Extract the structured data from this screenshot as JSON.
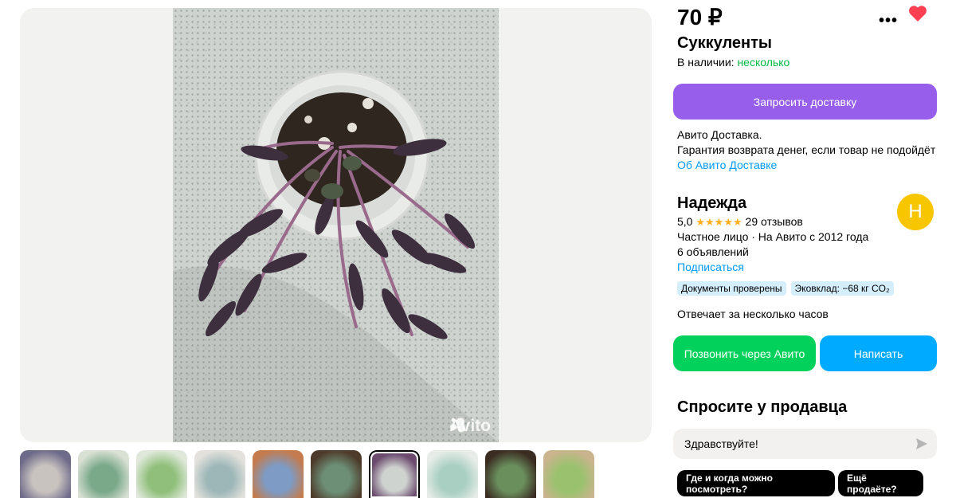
{
  "gallery": {
    "watermark": "Avito",
    "thumbnails": [
      {
        "colors": [
          "#c8c3bf",
          "#6e6a8a"
        ]
      },
      {
        "colors": [
          "#7aa98a",
          "#d9e0d4"
        ]
      },
      {
        "colors": [
          "#8fbf7a",
          "#dfe8da"
        ]
      },
      {
        "colors": [
          "#9db7b8",
          "#e3e1dc"
        ]
      },
      {
        "colors": [
          "#7d9bc4",
          "#c47b4d"
        ]
      },
      {
        "colors": [
          "#6d8f76",
          "#4d3a2a"
        ]
      },
      {
        "colors": [
          "#cfd3d0",
          "#6b4a6e"
        ],
        "active": true
      },
      {
        "colors": [
          "#a8cfc2",
          "#e7ece8"
        ]
      },
      {
        "colors": [
          "#6a8f5d",
          "#3b2c22"
        ]
      },
      {
        "colors": [
          "#9ac26e",
          "#c9b48d"
        ]
      }
    ]
  },
  "listing": {
    "price": "70 ₽",
    "title": "Суккуленты",
    "availability_label": "В наличии:",
    "availability_value": "несколько",
    "delivery_button": "Запросить доставку",
    "delivery_line1": "Авито Доставка.",
    "delivery_line2": "Гарантия возврата денег, если товар не подойдёт",
    "delivery_link": "Об Авито Доставке"
  },
  "seller": {
    "name": "Надежда",
    "avatar_letter": "Н",
    "rating": "5,0",
    "stars": "★★★★★",
    "reviews": "29 отзывов",
    "type": "Частное лицо · На Авито с 2012 года",
    "ads": "6 объявлений",
    "subscribe": "Подписаться",
    "badges": [
      "Документы проверены",
      "Эковклад: −68 кг CO₂"
    ],
    "response": "Отвечает за несколько часов",
    "call_button": "Позвонить через Авито",
    "write_button": "Написать"
  },
  "ask": {
    "title": "Спросите у продавца",
    "input_value": "Здравствуйте!",
    "chips": [
      "Где и когда можно посмотреть?",
      "Ещё продаёте?"
    ]
  },
  "colors": {
    "accent_purple": "#965eeb",
    "green": "#02d15c",
    "blue": "#00aaff",
    "heart": "#ff4053"
  }
}
